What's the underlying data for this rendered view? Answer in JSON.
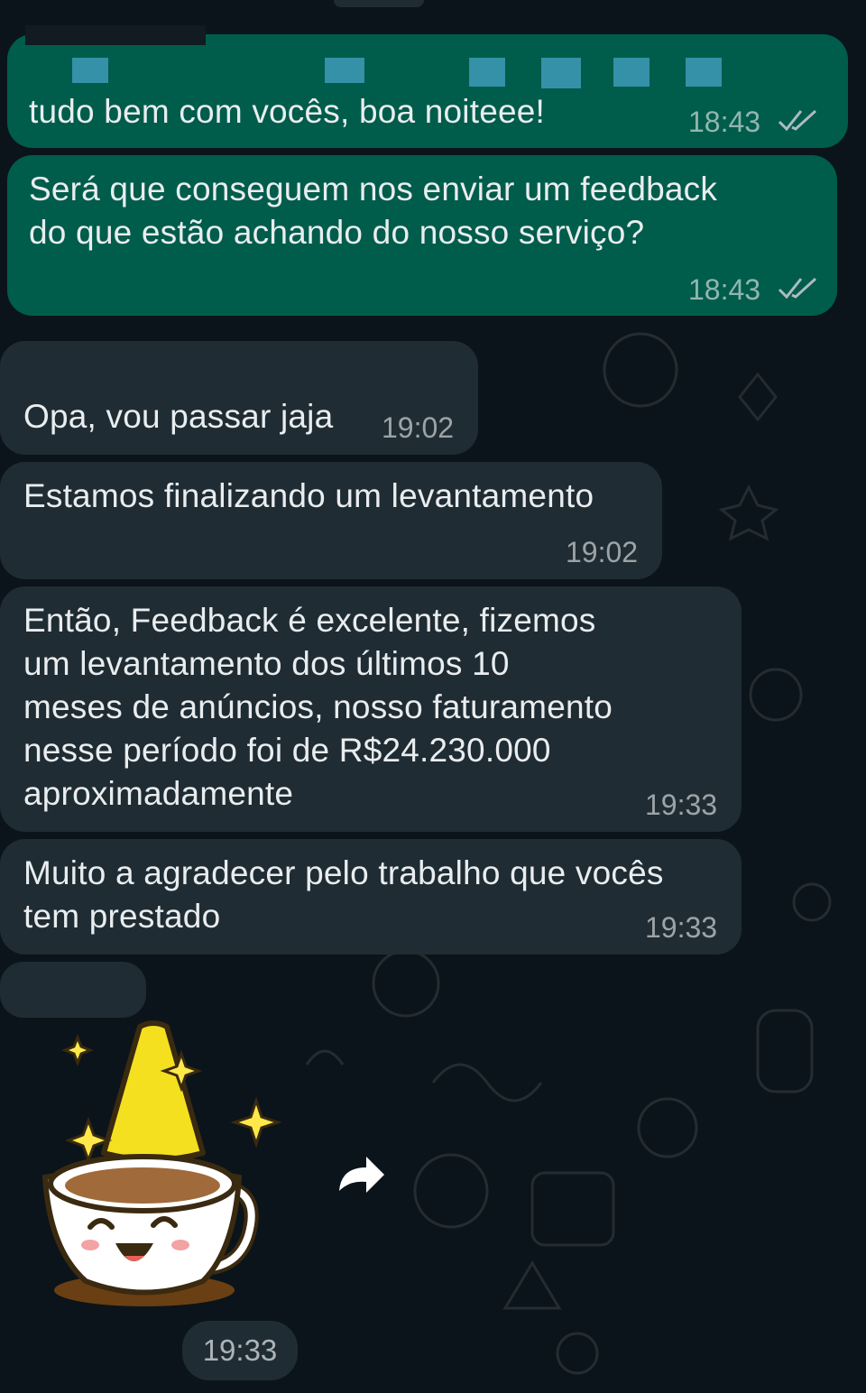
{
  "messages": [
    {
      "id": "m1",
      "dir": "out",
      "lines": [
        "tudo bem com vocês, boa noiteee!"
      ],
      "time": "18:43",
      "read": true
    },
    {
      "id": "m2",
      "dir": "out",
      "lines": [
        "Será que conseguem nos enviar um feedback",
        "do que estão achando do nosso serviço?"
      ],
      "time": "18:43",
      "read": true
    },
    {
      "id": "m3",
      "dir": "in",
      "lines": [
        "Opa, vou passar jaja"
      ],
      "time": "19:02"
    },
    {
      "id": "m4",
      "dir": "in",
      "lines": [
        "Estamos finalizando um levantamento"
      ],
      "time": "19:02"
    },
    {
      "id": "m5",
      "dir": "in",
      "lines": [
        "Então, Feedback é excelente, fizemos",
        "um levantamento dos últimos 10",
        "meses de anúncios, nosso faturamento",
        "nesse período foi de R$24.230.000",
        "aproximadamente"
      ],
      "time": "19:33"
    },
    {
      "id": "m6",
      "dir": "in",
      "lines": [
        "Muito a agradecer pelo trabalho que vocês",
        "tem prestado"
      ],
      "time": "19:33"
    }
  ],
  "sticker": {
    "time": "19:33",
    "icon": "coffee-cup-wizard-sticker"
  },
  "icons": {
    "read_receipt": "double-check-icon",
    "forward": "forward-icon"
  },
  "colors": {
    "background": "#0b141a",
    "outgoing": "#005c4b",
    "incoming": "#202c33",
    "text": "#e9edef"
  }
}
